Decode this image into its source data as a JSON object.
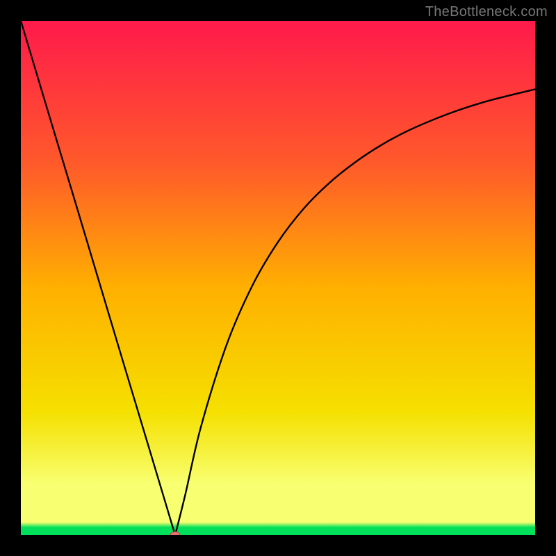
{
  "watermark": "TheBottleneck.com",
  "colors": {
    "frame": "#000000",
    "grad_top": "#ff1a4b",
    "grad_q1": "#ff5a2a",
    "grad_mid": "#ffb000",
    "grad_q3": "#f5e000",
    "grad_band": "#f8ff70",
    "grad_bottom": "#00e05a",
    "curve": "#000000",
    "marker_fill": "#e57373",
    "marker_stroke": "#c44545"
  },
  "chart_data": {
    "type": "line",
    "title": "",
    "xlabel": "",
    "ylabel": "",
    "xlim": [
      0,
      100
    ],
    "ylim": [
      0,
      100
    ],
    "grid": false,
    "series": [
      {
        "name": "bottleneck-curve",
        "x": [
          0,
          5,
          10,
          15,
          20,
          25,
          28,
          30,
          32,
          35,
          40,
          45,
          50,
          55,
          60,
          65,
          70,
          75,
          80,
          85,
          90,
          95,
          100
        ],
        "y": [
          100,
          83.3,
          66.7,
          50.0,
          33.3,
          16.7,
          6.7,
          0,
          8.0,
          21.0,
          37.0,
          48.5,
          57.0,
          63.5,
          68.5,
          72.5,
          75.8,
          78.5,
          80.7,
          82.6,
          84.2,
          85.5,
          86.7
        ]
      }
    ],
    "annotations": [
      {
        "name": "optimal-marker",
        "x": 30,
        "y": 0
      }
    ]
  }
}
